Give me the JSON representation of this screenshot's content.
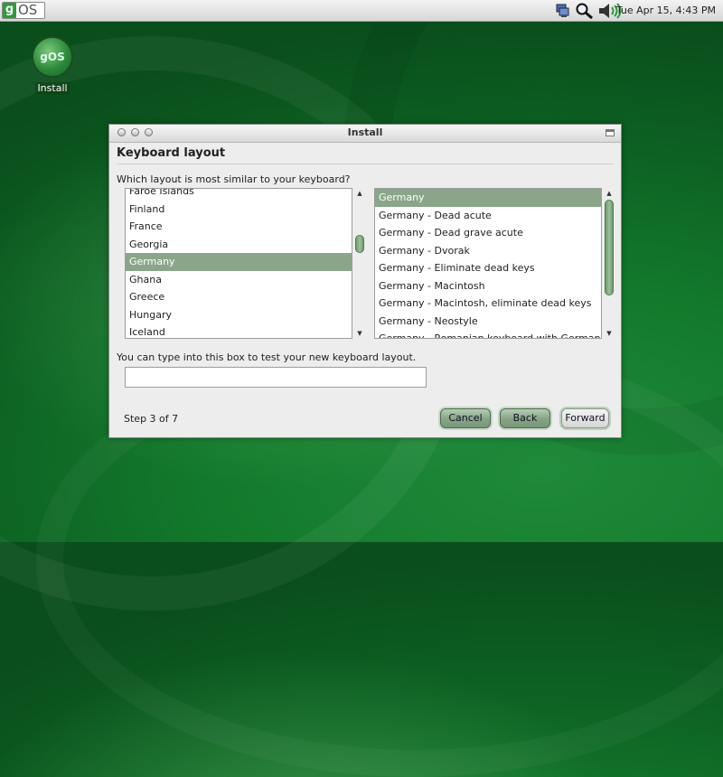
{
  "panel": {
    "logo_g": "g",
    "logo_os": "OS",
    "clock": "Tue Apr 15,  4:43 PM",
    "tray_icons": [
      "network-icon",
      "search-icon",
      "volume-icon"
    ]
  },
  "desktop": {
    "install_icon_label": "Install",
    "install_icon_glyph": "gOS"
  },
  "window": {
    "title": "Install",
    "heading": "Keyboard layout",
    "question": "Which layout is most similar to your keyboard?",
    "layouts": [
      {
        "label": "Faroe Islands"
      },
      {
        "label": "Finland"
      },
      {
        "label": "France"
      },
      {
        "label": "Georgia"
      },
      {
        "label": "Germany"
      },
      {
        "label": "Ghana"
      },
      {
        "label": "Greece"
      },
      {
        "label": "Hungary"
      },
      {
        "label": "Iceland"
      }
    ],
    "selected_layout": "Germany",
    "variants": [
      {
        "label": "Germany"
      },
      {
        "label": "Germany - Dead acute"
      },
      {
        "label": "Germany - Dead grave acute"
      },
      {
        "label": "Germany - Dvorak"
      },
      {
        "label": "Germany - Eliminate dead keys"
      },
      {
        "label": "Germany - Macintosh"
      },
      {
        "label": "Germany - Macintosh, eliminate dead keys"
      },
      {
        "label": "Germany - Neostyle"
      },
      {
        "label": "Germany - Romanian keyboard with German letters"
      }
    ],
    "selected_variant": "Germany",
    "test_label": "You can type into this box to test your new keyboard layout.",
    "test_value": "",
    "step": "Step 3 of 7",
    "buttons": {
      "cancel": "Cancel",
      "back": "Back",
      "forward": "Forward"
    }
  },
  "colors": {
    "selection": "#8aa58a",
    "desktop_green": "#137a2c",
    "button_green": "#86a386"
  }
}
